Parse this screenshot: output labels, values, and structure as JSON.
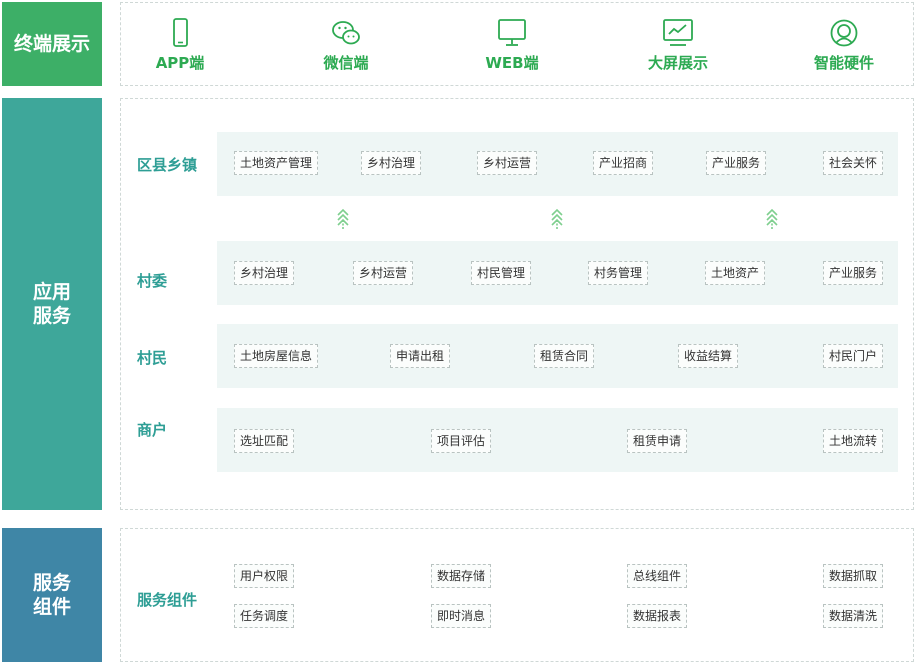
{
  "sections": {
    "terminal": {
      "title": "终端展示",
      "color": "#3daf67"
    },
    "application": {
      "title_line1": "应用",
      "title_line2": "服务",
      "color": "#3ea79a"
    },
    "service": {
      "title_line1": "服务",
      "title_line2": "组件",
      "color": "#3f86a6"
    }
  },
  "terminals": [
    {
      "label": "APP端",
      "icon": "phone-icon"
    },
    {
      "label": "微信端",
      "icon": "wechat-icon"
    },
    {
      "label": "WEB端",
      "icon": "monitor-icon"
    },
    {
      "label": "大屏展示",
      "icon": "dashboard-screen-icon"
    },
    {
      "label": "智能硬件",
      "icon": "hardware-icon"
    }
  ],
  "rows": [
    {
      "label": "区县乡镇",
      "items": [
        "土地资产管理",
        "乡村治理",
        "乡村运营",
        "产业招商",
        "产业服务",
        "社会关怀"
      ]
    },
    {
      "label": "村委",
      "items": [
        "乡村治理",
        "乡村运营",
        "村民管理",
        "村务管理",
        "土地资产",
        "产业服务"
      ]
    },
    {
      "label": "村民",
      "items": [
        "土地房屋信息",
        "申请出租",
        "租赁合同",
        "收益结算",
        "村民门户"
      ]
    },
    {
      "label": "商户",
      "items": [
        "选址匹配",
        "项目评估",
        "租赁申请",
        "土地流转"
      ]
    }
  ],
  "components": {
    "label": "服务组件",
    "row1": [
      "用户权限",
      "数据存储",
      "总线组件",
      "数据抓取"
    ],
    "row2": [
      "任务调度",
      "即时消息",
      "数据报表",
      "数据清洗"
    ]
  },
  "colors": {
    "accent_green": "#2daa52",
    "label_teal": "#2e9e95",
    "band": "#eef6f5"
  }
}
